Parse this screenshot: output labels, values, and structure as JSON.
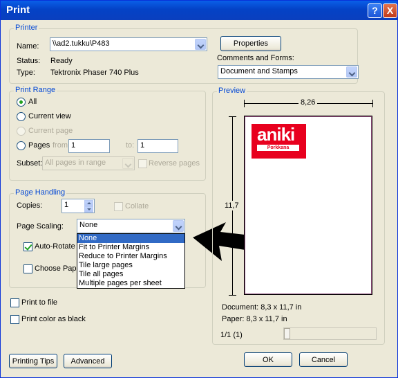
{
  "window": {
    "title": "Print",
    "help_glyph": "?",
    "close_glyph": "X"
  },
  "printer": {
    "group_label": "Printer",
    "name_label": "Name:",
    "name_value": "\\\\ad2.tukku\\P483",
    "status_label": "Status:",
    "status_value": "Ready",
    "type_label": "Type:",
    "type_value": "Tektronix Phaser 740 Plus",
    "properties_label": "Properties",
    "comments_label": "Comments and Forms:",
    "comments_value": "Document and Stamps"
  },
  "print_range": {
    "group_label": "Print Range",
    "all_label": "All",
    "current_view_label": "Current view",
    "current_page_label": "Current page",
    "pages_label": "Pages",
    "from_label": "from:",
    "from_value": "1",
    "to_label": "to:",
    "to_value": "1",
    "subset_label": "Subset:",
    "subset_value": "All pages in range",
    "reverse_label": "Reverse pages"
  },
  "page_handling": {
    "group_label": "Page Handling",
    "copies_label": "Copies:",
    "copies_value": "1",
    "collate_label": "Collate",
    "scaling_label": "Page Scaling:",
    "scaling_value": "None",
    "scaling_options": [
      "None",
      "Fit to Printer Margins",
      "Reduce to Printer Margins",
      "Tile large pages",
      "Tile all pages",
      "Multiple pages per sheet"
    ],
    "auto_rotate_label": "Auto-Rotate",
    "choose_paper_label": "Choose Pape"
  },
  "options": {
    "print_to_file_label": "Print to file",
    "print_color_black_label": "Print color as black"
  },
  "preview": {
    "group_label": "Preview",
    "width_label": "8,26",
    "height_label": "11,7",
    "logo_text": "aniki",
    "logo_subtext": "Porkkana",
    "document_size": "Document: 8,3 x 11,7 in",
    "paper_size": "Paper: 8,3 x 11,7 in",
    "page_indicator": "1/1 (1)"
  },
  "buttons": {
    "printing_tips": "Printing Tips",
    "advanced": "Advanced",
    "ok": "OK",
    "cancel": "Cancel"
  },
  "colors": {
    "title_bar": "#0442c6",
    "group_label": "#0046d5",
    "selection": "#316ac5",
    "logo": "#e8001e"
  }
}
